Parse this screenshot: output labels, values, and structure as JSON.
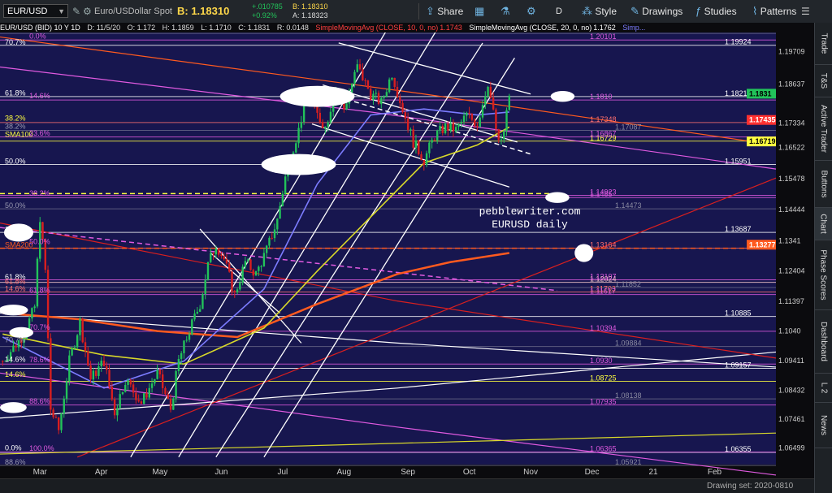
{
  "toolbar": {
    "symbol": "EUR/USD",
    "description": "Euro/USDollar Spot",
    "last": "B: 1.18310",
    "change": "+.010785",
    "change_pct": "+0.92%",
    "bid": "B: 1.18310",
    "ask": "A: 1.18323",
    "share": "Share",
    "period": "D",
    "style": "Style",
    "drawings": "Drawings",
    "studies": "Studies",
    "patterns": "Patterns"
  },
  "infobar": {
    "title": "EUR/USD (BID) 10 Y 1D",
    "date": "D: 11/5/20",
    "open": "O: 1.172",
    "high": "H: 1.1859",
    "low": "L: 1.1710",
    "close": "C: 1.1831",
    "range": "R: 0.0148",
    "sma10": "SimpleMovingAvg (CLOSE, 10, 0, no)",
    "sma10_val": "1.1743",
    "sma20": "SimpleMovingAvg (CLOSE, 20, 0, no)",
    "sma20_val": "1.1762",
    "more": "Simp..."
  },
  "sidebar": [
    "Trade",
    "T&S",
    "Active Trader",
    "Buttons",
    "Chart",
    "Phase Scores",
    "Dashboard",
    "L 2",
    "News"
  ],
  "status": "Drawing set: 2020-0810",
  "colors": {
    "bg": "#17164f",
    "up_candle": "#22c35a",
    "down_candle": "#d81f1f",
    "sma200": "#ff5a1f",
    "sma100": "#d8d82a",
    "sma50": "#7c7cff",
    "fib_magenta": "#e05ae0",
    "channel": "#ffffff"
  },
  "chart_data": {
    "type": "candlestick",
    "watermark": [
      "pebblewriter.com",
      "EURUSD daily"
    ],
    "ylim": [
      1.0595,
      1.2035
    ],
    "x_labels": [
      {
        "label": "Mar",
        "day": 6
      },
      {
        "label": "Apr",
        "day": 29
      },
      {
        "label": "May",
        "day": 51
      },
      {
        "label": "Jun",
        "day": 74
      },
      {
        "label": "Jul",
        "day": 97
      },
      {
        "label": "Aug",
        "day": 120
      },
      {
        "label": "Sep",
        "day": 144
      },
      {
        "label": "Oct",
        "day": 167
      },
      {
        "label": "Nov",
        "day": 190
      },
      {
        "label": "Dec",
        "day": 213
      },
      {
        "label": "21",
        "day": 236
      },
      {
        "label": "Feb",
        "day": 259
      }
    ],
    "x_range": [
      -9,
      282
    ],
    "y_ticks": [
      1.19709,
      1.18637,
      1.17334,
      1.16522,
      1.15478,
      1.14444,
      1.1341,
      1.12404,
      1.11397,
      1.104,
      1.09411,
      1.08432,
      1.07461,
      1.06499
    ],
    "price_path": [
      [
        -8,
        1.094
      ],
      [
        0,
        1.103
      ],
      [
        4,
        1.112
      ],
      [
        6,
        1.142
      ],
      [
        8,
        1.124
      ],
      [
        10,
        1.078
      ],
      [
        13,
        1.071
      ],
      [
        17,
        1.094
      ],
      [
        21,
        1.107
      ],
      [
        25,
        1.088
      ],
      [
        30,
        1.094
      ],
      [
        34,
        1.077
      ],
      [
        38,
        1.088
      ],
      [
        44,
        1.08
      ],
      [
        50,
        1.09
      ],
      [
        55,
        1.078
      ],
      [
        58,
        1.094
      ],
      [
        62,
        1.104
      ],
      [
        66,
        1.113
      ],
      [
        69,
        1.126
      ],
      [
        72,
        1.133
      ],
      [
        75,
        1.128
      ],
      [
        79,
        1.116
      ],
      [
        83,
        1.127
      ],
      [
        87,
        1.123
      ],
      [
        91,
        1.131
      ],
      [
        95,
        1.141
      ],
      [
        99,
        1.16
      ],
      [
        103,
        1.171
      ],
      [
        106,
        1.183
      ],
      [
        110,
        1.176
      ],
      [
        113,
        1.172
      ],
      [
        117,
        1.185
      ],
      [
        120,
        1.178
      ],
      [
        125,
        1.192
      ],
      [
        130,
        1.183
      ],
      [
        134,
        1.18
      ],
      [
        138,
        1.19
      ],
      [
        142,
        1.178
      ],
      [
        146,
        1.167
      ],
      [
        150,
        1.161
      ],
      [
        154,
        1.169
      ],
      [
        158,
        1.172
      ],
      [
        162,
        1.171
      ],
      [
        166,
        1.176
      ],
      [
        170,
        1.173
      ],
      [
        174,
        1.187
      ],
      [
        178,
        1.166
      ],
      [
        180,
        1.17
      ],
      [
        182,
        1.183
      ]
    ],
    "moving_averages": [
      {
        "name": "SMA200",
        "color": "#ff5a1f",
        "points": [
          [
            -8,
            1.11
          ],
          [
            20,
            1.108
          ],
          [
            50,
            1.104
          ],
          [
            80,
            1.102
          ],
          [
            110,
            1.113
          ],
          [
            140,
            1.123
          ],
          [
            160,
            1.127
          ],
          [
            182,
            1.13
          ]
        ]
      },
      {
        "name": "SMA100",
        "color": "#d8d82a",
        "points": [
          [
            -8,
            1.103
          ],
          [
            30,
            1.096
          ],
          [
            60,
            1.093
          ],
          [
            90,
            1.105
          ],
          [
            110,
            1.124
          ],
          [
            130,
            1.142
          ],
          [
            150,
            1.16
          ],
          [
            170,
            1.166
          ],
          [
            182,
            1.172
          ]
        ]
      },
      {
        "name": "SMA50",
        "color": "#7c7cff",
        "points": [
          [
            -8,
            1.102
          ],
          [
            30,
            1.085
          ],
          [
            60,
            1.094
          ],
          [
            90,
            1.118
          ],
          [
            110,
            1.153
          ],
          [
            130,
            1.176
          ],
          [
            150,
            1.178
          ],
          [
            170,
            1.176
          ],
          [
            182,
            1.177
          ]
        ]
      }
    ],
    "horizontal_levels": [
      {
        "value": 1.19924,
        "label": "1.19924",
        "color": "#ffffff"
      },
      {
        "value": 1.18216,
        "label": "1.18216",
        "color": "#ffffff"
      },
      {
        "value": 1.15951,
        "label": "1.15951",
        "color": "#ffffff"
      },
      {
        "value": 1.13687,
        "label": "1.13687",
        "color": "#ffffff"
      },
      {
        "value": 1.10885,
        "label": "1.10885",
        "color": "#ffffff"
      },
      {
        "value": 1.09157,
        "label": "1.09157",
        "color": "#ffffff"
      },
      {
        "value": 1.06355,
        "label": "1.06355",
        "color": "#ffffff"
      },
      {
        "value": 1.17348,
        "label": "1.17348",
        "color": "#ff7070"
      },
      {
        "value": 1.13164,
        "label": "1.13164",
        "color": "#ff7070"
      },
      {
        "value": 1.11703,
        "label": "1.11703",
        "color": "#ff7070"
      },
      {
        "value": 1.12024,
        "label": "1.12024",
        "color": "#ffd0d0"
      },
      {
        "value": 1.16729,
        "label": "1.16729",
        "color": "#ffff40"
      },
      {
        "value": 1.08725,
        "label": "1.08725",
        "color": "#ffff40"
      },
      {
        "value": 1.20101,
        "label": "1.20101",
        "color": "#e05ae0"
      },
      {
        "value": 1.181,
        "label": "1.1810",
        "color": "#e05ae0"
      },
      {
        "value": 1.16867,
        "label": "1.16867",
        "color": "#e05ae0"
      },
      {
        "value": 1.1485,
        "label": "1.1485",
        "color": "#e05ae0"
      },
      {
        "value": 1.11617,
        "label": "1.11617",
        "color": "#e05ae0"
      },
      {
        "value": 1.10394,
        "label": "1.10394",
        "color": "#e05ae0"
      },
      {
        "value": 1.093,
        "label": "1.0930",
        "color": "#e05ae0"
      },
      {
        "value": 1.07935,
        "label": "1.07935",
        "color": "#e05ae0"
      },
      {
        "value": 1.06365,
        "label": "1.06365",
        "color": "#e05ae0"
      },
      {
        "value": 1.20321,
        "label": "1.20321",
        "color": "#6b6b8a"
      },
      {
        "value": 1.17087,
        "label": "1.17087",
        "color": "#6b6b8a"
      },
      {
        "value": 1.14473,
        "label": "1.14473",
        "color": "#6b6b8a"
      },
      {
        "value": 1.11852,
        "label": "1.11852",
        "color": "#6b6b8a"
      },
      {
        "value": 1.09884,
        "label": "1.09884",
        "color": "#6b6b8a"
      },
      {
        "value": 1.08138,
        "label": "1.08138",
        "color": "#6b6b8a"
      },
      {
        "value": 1.05921,
        "label": "1.05921",
        "color": "#6b6b8a"
      },
      {
        "value": 1.14923,
        "label": "1.14923",
        "color": "#e05ae0"
      },
      {
        "value": 1.12107,
        "label": "1.12107",
        "color": "#e05ae0"
      }
    ],
    "price_badges": [
      {
        "value": 1.1831,
        "label": "1.1831",
        "bg": "#22c35a",
        "fg": "#000000"
      },
      {
        "value": 1.17435,
        "label": "1.17435",
        "bg": "#ff3030",
        "fg": "#ffffff"
      },
      {
        "value": 1.16719,
        "label": "1.16719",
        "bg": "#ffff40",
        "fg": "#000000"
      },
      {
        "value": 1.13277,
        "label": "1.13277",
        "bg": "#ff5a1f",
        "fg": "#ffffff"
      }
    ],
    "fib_labels_left": [
      {
        "text": "23.6%",
        "value": 1.2032,
        "color": "#9a9ab0"
      },
      {
        "text": "70.7%",
        "value": 1.1992,
        "color": "#ffffff"
      },
      {
        "text": "61.8%",
        "value": 1.1822,
        "color": "#ffffff"
      },
      {
        "text": "38.2%",
        "value": 1.1738,
        "color": "#ffff40"
      },
      {
        "text": "38.2%",
        "value": 1.1712,
        "color": "#9a9ab0"
      },
      {
        "text": "SMA100",
        "value": 1.1685,
        "color": "#ffff40"
      },
      {
        "text": "50.0%",
        "value": 1.1595,
        "color": "#ffffff"
      },
      {
        "text": "50.0%",
        "value": 1.1447,
        "color": "#9a9ab0"
      },
      {
        "text": "38.2%",
        "value": 1.1368,
        "color": "#ffffff"
      },
      {
        "text": "SMA200",
        "value": 1.1316,
        "color": "#ff5a1f"
      },
      {
        "text": "61.8%",
        "value": 1.121,
        "color": "#ffffff"
      },
      {
        "text": "61.8%",
        "value": 1.1195,
        "color": "#ff7070"
      },
      {
        "text": "14.6%",
        "value": 1.117,
        "color": "#ff7070"
      },
      {
        "text": "70.7%",
        "value": 1.1,
        "color": "#9a9ab0"
      },
      {
        "text": "14.6%",
        "value": 1.0935,
        "color": "#ffffff"
      },
      {
        "text": "14.6%",
        "value": 1.0885,
        "color": "#ffff40"
      },
      {
        "text": "0.0%",
        "value": 1.064,
        "color": "#ffffff"
      },
      {
        "text": "88.6%",
        "value": 1.0592,
        "color": "#9a9ab0"
      }
    ],
    "fib_labels_inner": [
      {
        "text": "0.0%",
        "day": 2,
        "value": 1.201
      },
      {
        "text": "14.6%",
        "day": 2,
        "value": 1.181
      },
      {
        "text": "23.6%",
        "day": 2,
        "value": 1.1686
      },
      {
        "text": "38.2%",
        "day": 2,
        "value": 1.1485
      },
      {
        "text": "50.0%",
        "day": 2,
        "value": 1.1325
      },
      {
        "text": "61.8%",
        "day": 2,
        "value": 1.1162
      },
      {
        "text": "70.7%",
        "day": 2,
        "value": 1.1039
      },
      {
        "text": "78.6%",
        "day": 2,
        "value": 1.093
      },
      {
        "text": "88.6%",
        "day": 2,
        "value": 1.0793
      },
      {
        "text": "100.0%",
        "day": 2,
        "value": 1.0636
      }
    ],
    "channels": [
      {
        "color": "#ffffff",
        "lines": [
          [
            [
              40,
              1.062
            ],
            [
              150,
              1.225
            ]
          ],
          [
            [
              58,
              1.062
            ],
            [
              160,
              1.212
            ]
          ],
          [
            [
              72,
              1.062
            ],
            [
              172,
              1.2
            ]
          ],
          [
            [
              90,
              1.062
            ],
            [
              184,
              1.195
            ]
          ]
        ]
      },
      {
        "color": "#ffffff",
        "lines": [
          [
            [
              118,
              1.2
            ],
            [
              190,
              1.183
            ]
          ],
          [
            [
              112,
              1.186
            ],
            [
              185,
              1.167
            ]
          ],
          [
            [
              108,
              1.173
            ],
            [
              182,
              1.152
            ]
          ]
        ]
      },
      {
        "color": "#ffffff",
        "lines": [
          [
            [
              66,
              1.138
            ],
            [
              104,
              1.1
            ]
          ],
          [
            [
              70,
              1.13
            ],
            [
              96,
              1.11
            ]
          ]
        ]
      }
    ],
    "trendlines": [
      {
        "color": "#ff5a1f",
        "points": [
          [
            -9,
            1.202
          ],
          [
            150,
            1.183
          ],
          [
            282,
            1.166
          ]
        ]
      },
      {
        "color": "#e05ae0",
        "points": [
          [
            -9,
            1.192
          ],
          [
            130,
            1.177
          ],
          [
            282,
            1.158
          ]
        ]
      },
      {
        "color": "#e05ae0",
        "points": [
          [
            -9,
            1.09
          ],
          [
            140,
            1.072
          ],
          [
            282,
            1.056
          ]
        ]
      },
      {
        "color": "#ffffff",
        "points": [
          [
            -9,
            1.075
          ],
          [
            140,
            1.085
          ],
          [
            282,
            1.097
          ]
        ]
      },
      {
        "color": "#ffffff",
        "points": [
          [
            -9,
            1.11
          ],
          [
            140,
            1.1
          ],
          [
            282,
            1.092
          ]
        ]
      },
      {
        "color": "#d81f1f",
        "points": [
          [
            -9,
            1.14
          ],
          [
            140,
            1.114
          ],
          [
            282,
            1.095
          ]
        ]
      },
      {
        "color": "#d81f1f",
        "points": [
          [
            20,
            1.062
          ],
          [
            282,
            1.155
          ]
        ]
      },
      {
        "color": "#d8d82a",
        "points": [
          [
            -9,
            1.063
          ],
          [
            282,
            1.07
          ]
        ]
      }
    ],
    "dashed_lines": [
      {
        "color": "#ffff40",
        "points": [
          [
            -9,
            1.1498
          ],
          [
            200,
            1.1498
          ]
        ]
      },
      {
        "color": "#ff5a1f",
        "points": [
          [
            -9,
            1.1316
          ],
          [
            282,
            1.1316
          ]
        ]
      },
      {
        "color": "#e05ae0",
        "points": [
          [
            -9,
            1.1385
          ],
          [
            200,
            1.1175
          ]
        ]
      },
      {
        "color": "#ffffff",
        "points": [
          [
            118,
            1.182
          ],
          [
            190,
            1.163
          ]
        ]
      }
    ],
    "ellipses": [
      {
        "cx": 110,
        "cy": 1.1822,
        "rx": 14,
        "ry": 0.0035
      },
      {
        "cx": 103,
        "cy": 1.1595,
        "rx": 14,
        "ry": 0.0035
      },
      {
        "cx": 202,
        "cy": 1.1822,
        "rx": 4.5,
        "ry": 0.0018
      },
      {
        "cx": 200,
        "cy": 1.1485,
        "rx": 4.5,
        "ry": 0.0018
      },
      {
        "cx": 210,
        "cy": 1.13,
        "rx": 3.5,
        "ry": 0.003
      },
      {
        "cx": -2,
        "cy": 1.1368,
        "rx": 5.5,
        "ry": 0.003
      },
      {
        "cx": -4,
        "cy": 1.111,
        "rx": 5.5,
        "ry": 0.0018
      },
      {
        "cx": -1,
        "cy": 1.1035,
        "rx": 4.5,
        "ry": 0.0018
      },
      {
        "cx": -4,
        "cy": 1.0785,
        "rx": 5,
        "ry": 0.0018
      }
    ]
  }
}
